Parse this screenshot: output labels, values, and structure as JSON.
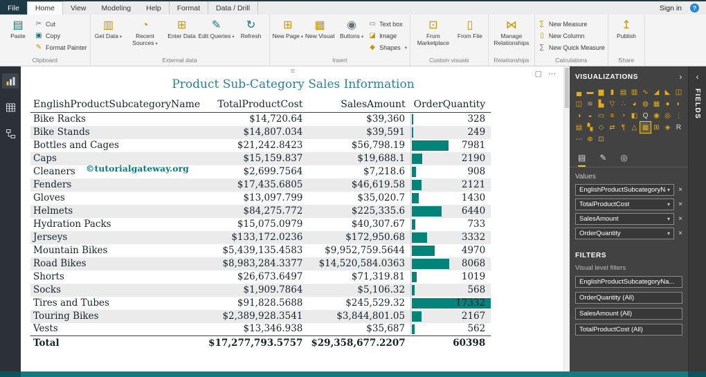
{
  "window": {
    "sign_in_label": "Sign in",
    "help_glyph": "?"
  },
  "tabs": [
    {
      "label": "File",
      "variant": "file"
    },
    {
      "label": "Home",
      "variant": "active"
    },
    {
      "label": "View"
    },
    {
      "label": "Modeling"
    },
    {
      "label": "Help"
    },
    {
      "label": "Format",
      "variant": "contextual"
    },
    {
      "label": "Data / Drill",
      "variant": "contextual"
    }
  ],
  "ribbon": {
    "groups": [
      {
        "label": "Clipboard",
        "big": [
          {
            "label": "Paste",
            "icon": "paste-clipboard-icon",
            "glyph": "▤",
            "tone": "teal"
          }
        ],
        "small": [
          {
            "label": "Cut",
            "icon": "cut-scissors-icon",
            "glyph": "✂",
            "tone": "gray"
          },
          {
            "label": "Copy",
            "icon": "copy-icon",
            "glyph": "▣",
            "tone": "teal"
          },
          {
            "label": "Format Painter",
            "icon": "format-painter-icon",
            "glyph": "✎",
            "tone": "amber"
          }
        ]
      },
      {
        "label": "External data",
        "big": [
          {
            "label": "Get Data",
            "icon": "get-data-icon",
            "glyph": "▥",
            "tone": "amber",
            "caret": true
          },
          {
            "label": "Recent Sources",
            "icon": "recent-sources-icon",
            "glyph": "◔",
            "tone": "amber",
            "caret": true
          },
          {
            "label": "Enter Data",
            "icon": "enter-data-icon",
            "glyph": "⊞",
            "tone": "amber"
          },
          {
            "label": "Edit Queries",
            "icon": "edit-queries-icon",
            "glyph": "✎",
            "tone": "teal",
            "caret": true
          },
          {
            "label": "Refresh",
            "icon": "refresh-icon",
            "glyph": "↻",
            "tone": "teal"
          }
        ]
      },
      {
        "label": "Insert",
        "big": [
          {
            "label": "New Page",
            "icon": "new-page-icon",
            "glyph": "⊞",
            "tone": "amber",
            "caret": true
          },
          {
            "label": "New Visual",
            "icon": "new-visual-icon",
            "glyph": "▦",
            "tone": "amber"
          },
          {
            "label": "Buttons",
            "icon": "buttons-icon",
            "glyph": "◉",
            "tone": "gray",
            "caret": true
          }
        ],
        "small": [
          {
            "label": "Text box",
            "icon": "text-box-icon",
            "glyph": "▭",
            "tone": "gray"
          },
          {
            "label": "Image",
            "icon": "image-icon",
            "glyph": "◪",
            "tone": "amber"
          },
          {
            "label": "Shapes",
            "icon": "shapes-icon",
            "glyph": "◆",
            "tone": "amber",
            "caret": true
          }
        ]
      },
      {
        "label": "Custom visuals",
        "big": [
          {
            "label": "From Marketplace",
            "icon": "from-marketplace-icon",
            "glyph": "⊡",
            "tone": "amber"
          },
          {
            "label": "From File",
            "icon": "from-file-icon",
            "glyph": "▯",
            "tone": "amber"
          }
        ]
      },
      {
        "label": "Relationships",
        "big": [
          {
            "label": "Manage Relationships",
            "icon": "manage-relationships-icon",
            "glyph": "⋈",
            "tone": "amber"
          }
        ]
      },
      {
        "label": "Calculations",
        "small": [
          {
            "label": "New Measure",
            "icon": "new-measure-icon",
            "glyph": "∑",
            "tone": "amber"
          },
          {
            "label": "New Column",
            "icon": "new-column-icon",
            "glyph": "▯",
            "tone": "amber"
          },
          {
            "label": "New Quick Measure",
            "icon": "new-quick-measure-icon",
            "glyph": "∑",
            "tone": "gray"
          }
        ]
      },
      {
        "label": "Share",
        "big": [
          {
            "label": "Publish",
            "icon": "publish-icon",
            "glyph": "↥",
            "tone": "amber"
          }
        ]
      }
    ]
  },
  "leftnav": {
    "items": [
      {
        "icon": "report-view-icon",
        "selected": true
      },
      {
        "icon": "data-view-icon"
      },
      {
        "icon": "model-view-icon"
      }
    ]
  },
  "canvas": {
    "visual_grip_glyph": "≡",
    "focus_mode_glyph": "▢",
    "more_options_glyph": "⋯",
    "table": {
      "title": "Product Sub-Category Sales Information",
      "watermark": "©tutorialgateway.org",
      "columns": [
        "EnglishProductSubcategoryName",
        "TotalProductCost",
        "SalesAmount",
        "OrderQuantity"
      ],
      "order_quantity_max": 17332,
      "bar_color": "#03847b",
      "title_color": "#2e7f9f",
      "rows": [
        {
          "name": "Bike Racks",
          "total_product_cost": "$14,720.64",
          "sales_amount": "$39,360",
          "order_quantity": 328
        },
        {
          "name": "Bike Stands",
          "total_product_cost": "$14,807.034",
          "sales_amount": "$39,591",
          "order_quantity": 249
        },
        {
          "name": "Bottles and Cages",
          "total_product_cost": "$21,242.8423",
          "sales_amount": "$56,798.19",
          "order_quantity": 7981
        },
        {
          "name": "Caps",
          "total_product_cost": "$15,159.837",
          "sales_amount": "$19,688.1",
          "order_quantity": 2190
        },
        {
          "name": "Cleaners",
          "total_product_cost": "$2,699.7564",
          "sales_amount": "$7,218.6",
          "order_quantity": 908
        },
        {
          "name": "Fenders",
          "total_product_cost": "$17,435.6805",
          "sales_amount": "$46,619.58",
          "order_quantity": 2121
        },
        {
          "name": "Gloves",
          "total_product_cost": "$13,097.799",
          "sales_amount": "$35,020.7",
          "order_quantity": 1430
        },
        {
          "name": "Helmets",
          "total_product_cost": "$84,275.772",
          "sales_amount": "$225,335.6",
          "order_quantity": 6440
        },
        {
          "name": "Hydration Packs",
          "total_product_cost": "$15,075.0979",
          "sales_amount": "$40,307.67",
          "order_quantity": 733
        },
        {
          "name": "Jerseys",
          "total_product_cost": "$133,172.0236",
          "sales_amount": "$172,950.68",
          "order_quantity": 3332
        },
        {
          "name": "Mountain Bikes",
          "total_product_cost": "$5,439,135.4583",
          "sales_amount": "$9,952,759.5644",
          "order_quantity": 4970
        },
        {
          "name": "Road Bikes",
          "total_product_cost": "$8,983,284.3377",
          "sales_amount": "$14,520,584.0363",
          "order_quantity": 8068
        },
        {
          "name": "Shorts",
          "total_product_cost": "$26,673.6497",
          "sales_amount": "$71,319.81",
          "order_quantity": 1019
        },
        {
          "name": "Socks",
          "total_product_cost": "$1,909.7864",
          "sales_amount": "$5,106.32",
          "order_quantity": 568
        },
        {
          "name": "Tires and Tubes",
          "total_product_cost": "$91,828.5688",
          "sales_amount": "$245,529.32",
          "order_quantity": 17332
        },
        {
          "name": "Touring Bikes",
          "total_product_cost": "$2,389,928.3541",
          "sales_amount": "$3,844,801.05",
          "order_quantity": 2167
        },
        {
          "name": "Vests",
          "total_product_cost": "$13,346.938",
          "sales_amount": "$35,687",
          "order_quantity": 562
        }
      ],
      "total": {
        "name": "Total",
        "total_product_cost": "$17,277,793.5757",
        "sales_amount": "$29,358,677.2207",
        "order_quantity": "60398"
      }
    }
  },
  "visualizations": {
    "title": "VISUALIZATIONS",
    "collapse_glyph": "›",
    "caret_glyph": "▾",
    "remove_glyph": "×",
    "values_label": "Values",
    "icons": [
      {
        "name": "stacked-bar-chart",
        "glyph": "▄"
      },
      {
        "name": "clustered-bar-chart",
        "glyph": "▬"
      },
      {
        "name": "stacked-column-chart",
        "glyph": "▆"
      },
      {
        "name": "clustered-column-chart",
        "glyph": "▮"
      },
      {
        "name": "100-stacked-bar-chart",
        "glyph": "▤"
      },
      {
        "name": "100-stacked-column-chart",
        "glyph": "▥"
      },
      {
        "name": "line-chart",
        "glyph": "∿"
      },
      {
        "name": "area-chart",
        "glyph": "◢"
      },
      {
        "name": "stacked-area-chart",
        "glyph": "◣"
      },
      {
        "name": "line-and-stacked-column-chart",
        "glyph": "◫"
      },
      {
        "name": "line-and-clustered-column-chart",
        "glyph": "◫"
      },
      {
        "name": "ribbon-chart",
        "glyph": "≋"
      },
      {
        "name": "waterfall-chart",
        "glyph": "▙"
      },
      {
        "name": "funnel-chart",
        "glyph": "▽"
      },
      {
        "name": "scatter-chart",
        "glyph": "∴"
      },
      {
        "name": "pie-chart",
        "glyph": "◕"
      },
      {
        "name": "donut-chart",
        "glyph": "◍"
      },
      {
        "name": "treemap",
        "glyph": "▦"
      },
      {
        "name": "map",
        "glyph": "●"
      },
      {
        "name": "filled-map",
        "glyph": "◐"
      },
      {
        "name": "shape-map",
        "glyph": "◑"
      },
      {
        "name": "gauge",
        "glyph": "◒"
      },
      {
        "name": "card",
        "glyph": "▭"
      },
      {
        "name": "multi-row-card",
        "glyph": "≡"
      },
      {
        "name": "kpi",
        "glyph": "◔"
      },
      {
        "name": "slicer",
        "glyph": "◧"
      },
      {
        "name": "q-and-a-visual",
        "glyph": "Q",
        "tone": "white"
      },
      {
        "name": "arcgis-map",
        "glyph": "◉"
      },
      {
        "name": "key-influencers",
        "glyph": "◎"
      },
      {
        "name": "decomposition-tree",
        "glyph": "⋮"
      },
      {
        "name": "paginated-report",
        "glyph": "▤"
      },
      {
        "name": "python-visual",
        "glyph": "▚"
      },
      {
        "name": "power-apps",
        "glyph": "◇"
      },
      {
        "name": "power-automate",
        "glyph": "⇄"
      },
      {
        "name": "smart-narrative",
        "glyph": "¶"
      },
      {
        "name": "metrics",
        "glyph": "△"
      },
      {
        "name": "table",
        "glyph": "▦",
        "selected": true
      },
      {
        "name": "matrix",
        "glyph": "⊞"
      },
      {
        "name": "custom-visual",
        "glyph": "◈"
      },
      {
        "name": "r-script-visual",
        "glyph": "R",
        "tone": "white"
      },
      {
        "name": "more-visuals",
        "glyph": "⋯",
        "tone": "white"
      },
      {
        "name": "import-visual",
        "glyph": "⊕"
      },
      {
        "name": "marketplace-visual",
        "glyph": "⊡"
      }
    ],
    "pane_tabs": [
      {
        "name": "fields-pane-tab",
        "glyph": "▤",
        "selected": true
      },
      {
        "name": "format-pane-tab",
        "glyph": "✎"
      },
      {
        "name": "analytics-pane-tab",
        "glyph": "◎"
      }
    ],
    "value_fields": [
      {
        "label": "EnglishProductSubcategoryNa"
      },
      {
        "label": "TotalProductCost"
      },
      {
        "label": "SalesAmount"
      },
      {
        "label": "OrderQuantity"
      }
    ]
  },
  "filters": {
    "title": "FILTERS",
    "section_label": "Visual level filters",
    "items": [
      {
        "label": "EnglishProductSubcategoryNa..."
      },
      {
        "label": "OrderQuantity  (All)"
      },
      {
        "label": "SalesAmount  (All)"
      },
      {
        "label": "TotalProductCost  (All)"
      }
    ]
  },
  "fields_panel": {
    "title": "FIELDS",
    "collapse_glyph": "‹"
  }
}
